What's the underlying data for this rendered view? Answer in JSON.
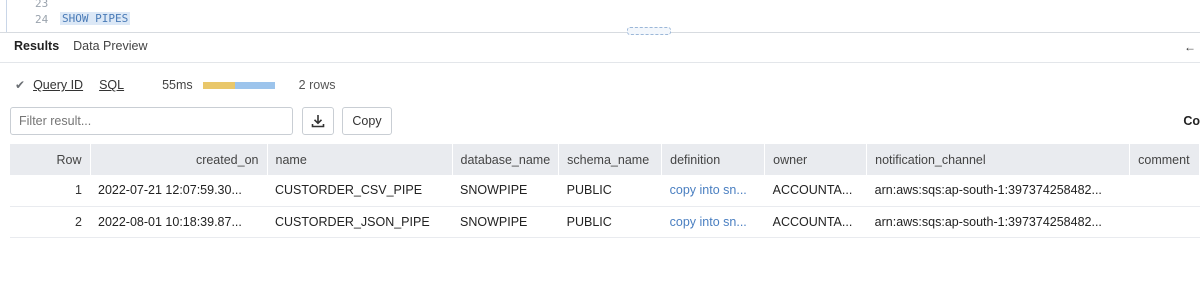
{
  "editor": {
    "lines": [
      {
        "num": "23",
        "code": ""
      },
      {
        "num": "24",
        "code": "SHOW PIPES"
      }
    ]
  },
  "tabs": [
    {
      "label": "Results",
      "active": true
    },
    {
      "label": "Data Preview",
      "active": false
    }
  ],
  "query_info": {
    "query_id_label": "Query ID",
    "sql_label": "SQL",
    "duration": "55ms",
    "rows": "2 rows",
    "progress": {
      "compile_fraction": 0.45,
      "exec_fraction": 0.55
    }
  },
  "filter": {
    "placeholder": "Filter result..."
  },
  "buttons": {
    "copy": "Copy"
  },
  "right_cut_text": "Co",
  "table": {
    "headers": [
      "Row",
      "created_on",
      "name",
      "database_name",
      "schema_name",
      "definition",
      "owner",
      "notification_channel",
      "comment"
    ],
    "rows": [
      [
        "1",
        "2022-07-21 12:07:59.30...",
        "CUSTORDER_CSV_PIPE",
        "SNOWPIPE",
        "PUBLIC",
        "copy into sn...",
        "ACCOUNTA...",
        "arn:aws:sqs:ap-south-1:397374258482...",
        ""
      ],
      [
        "2",
        "2022-08-01 10:18:39.87...",
        "CUSTORDER_JSON_PIPE",
        "SNOWPIPE",
        "PUBLIC",
        "copy into sn...",
        "ACCOUNTA...",
        "arn:aws:sqs:ap-south-1:397374258482...",
        ""
      ]
    ]
  },
  "colors": {
    "link_blue": "#4a7fc1",
    "header_bg": "#e9ebef",
    "progress_compile": "#e9c76a",
    "progress_exec": "#9cc4ec"
  }
}
